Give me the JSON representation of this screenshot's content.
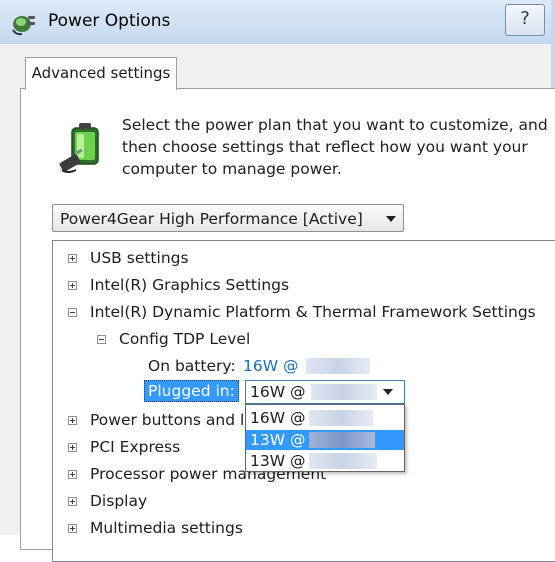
{
  "window": {
    "title": "Power Options",
    "help_label": "?"
  },
  "tab": {
    "label": "Advanced settings"
  },
  "description": "Select the power plan that you want to customize, and then choose settings that reflect how you want your computer to manage power.",
  "plan_select": {
    "value": "Power4Gear High Performance [Active]"
  },
  "tree": {
    "usb": "USB settings",
    "graphics": "Intel(R) Graphics Settings",
    "dptf": "Intel(R) Dynamic Platform & Thermal Framework Settings",
    "config_tdp": "Config TDP Level",
    "on_battery_label": "On battery:",
    "on_battery_value": "16W @",
    "plugged_in_label": "Plugged in:",
    "power_buttons": "Power buttons and lid",
    "pci": "PCI Express",
    "processor": "Processor power management",
    "display": "Display",
    "multimedia": "Multimedia settings"
  },
  "plugged_combo": {
    "value": "16W @",
    "options": [
      "16W @",
      "13W @",
      "13W @"
    ],
    "selected_index": 1
  },
  "icons": {
    "app": "power-plug-icon",
    "battery": "battery-plug-icon",
    "expander_plus": "plus-box-icon",
    "expander_minus": "minus-box-icon",
    "dropdown": "chevron-down-icon"
  }
}
